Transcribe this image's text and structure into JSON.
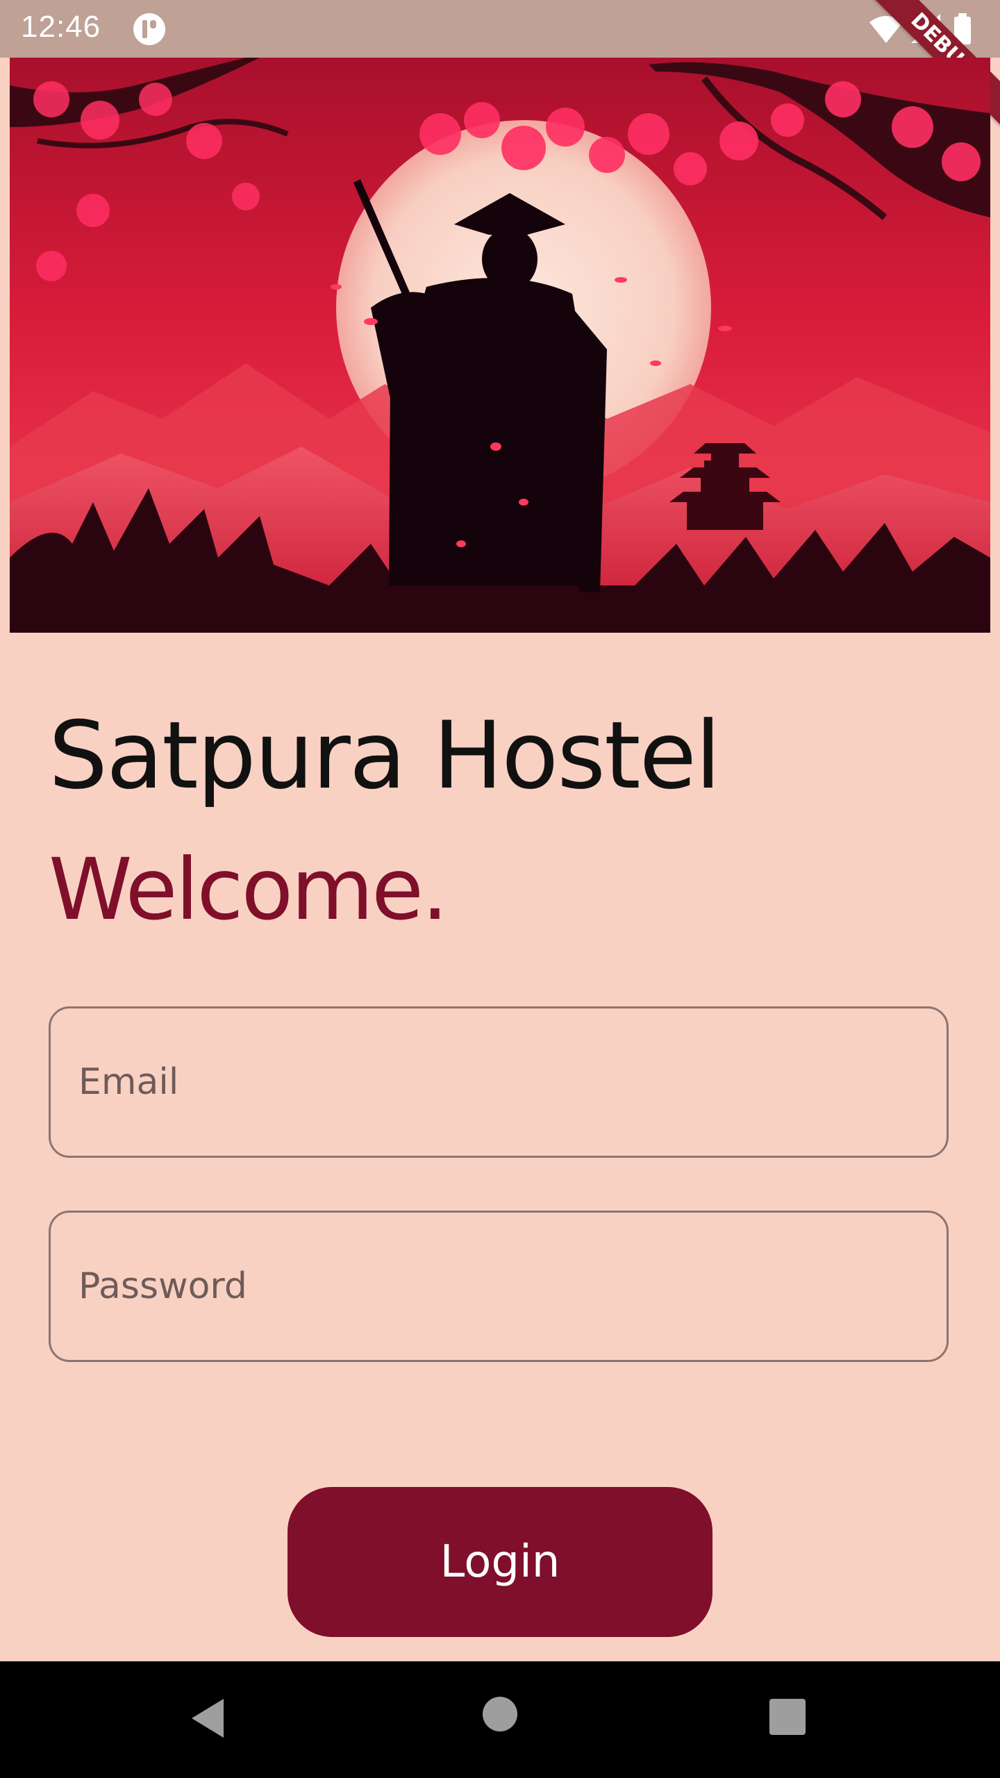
{
  "status_bar": {
    "time": "12:46",
    "debug_label": "DEBUG"
  },
  "main": {
    "title": "Satpura Hostel",
    "welcome": "Welcome.",
    "email_placeholder": "Email",
    "password_placeholder": "Password",
    "login_label": "Login"
  },
  "colors": {
    "background": "#f9d1c2",
    "accent": "#7f0f2b",
    "status_bar": "#bfa196"
  },
  "icons": {
    "status": [
      "app-notification-icon",
      "wifi-icon",
      "signal-icon",
      "battery-icon"
    ],
    "navigation": [
      "back-icon",
      "home-icon",
      "recents-icon"
    ]
  }
}
